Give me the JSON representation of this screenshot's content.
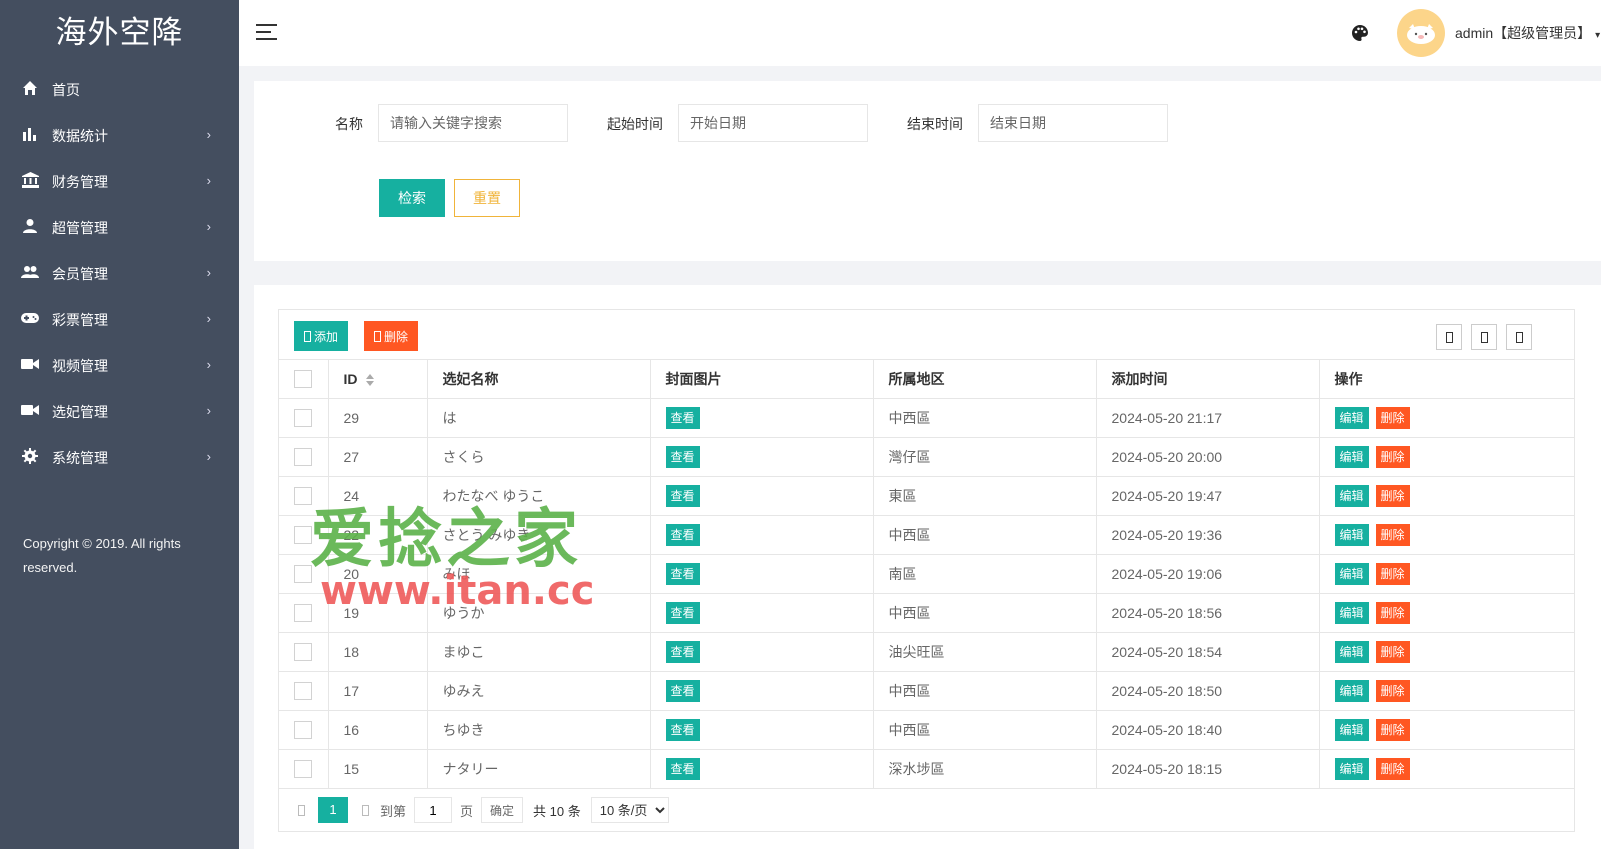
{
  "app": {
    "brand": "海外空降",
    "copyright": "Copyright © 2019. All rights reserved."
  },
  "sidebar": {
    "items": [
      {
        "label": "首页",
        "icon": "home-icon",
        "has_children": false
      },
      {
        "label": "数据统计",
        "icon": "bar-chart-icon",
        "has_children": true
      },
      {
        "label": "财务管理",
        "icon": "bank-icon",
        "has_children": true
      },
      {
        "label": "超管管理",
        "icon": "user-icon",
        "has_children": true
      },
      {
        "label": "会员管理",
        "icon": "users-icon",
        "has_children": true
      },
      {
        "label": "彩票管理",
        "icon": "gamepad-icon",
        "has_children": true
      },
      {
        "label": "视频管理",
        "icon": "video-camera-icon",
        "has_children": true
      },
      {
        "label": "选妃管理",
        "icon": "video-camera-icon",
        "has_children": true
      },
      {
        "label": "系统管理",
        "icon": "gear-icon",
        "has_children": true
      }
    ],
    "arrow": "›"
  },
  "header": {
    "user": "admin【超级管理员】",
    "caret": "▾"
  },
  "search": {
    "name_label": "名称",
    "name_placeholder": "请输入关键字搜索",
    "start_label": "起始时间",
    "start_placeholder": "开始日期",
    "end_label": "结束时间",
    "end_placeholder": "结束日期",
    "search_button": "检索",
    "reset_button": "重置"
  },
  "toolbar": {
    "add_label": "添加",
    "delete_label": "删除"
  },
  "table": {
    "columns": [
      "ID",
      "选妃名称",
      "封面图片",
      "所属地区",
      "添加时间",
      "操作"
    ],
    "view_label": "查看",
    "edit_label": "编辑",
    "remove_label": "删除",
    "rows": [
      {
        "id": "29",
        "name": "は",
        "region": "中西區",
        "time": "2024-05-20 21:17"
      },
      {
        "id": "27",
        "name": "さくら",
        "region": "灣仔區",
        "time": "2024-05-20 20:00"
      },
      {
        "id": "24",
        "name": "わたなべ ゆうこ",
        "region": "東區",
        "time": "2024-05-20 19:47"
      },
      {
        "id": "22",
        "name": "さとう みゆき",
        "region": "中西區",
        "time": "2024-05-20 19:36"
      },
      {
        "id": "20",
        "name": "みほ",
        "region": "南區",
        "time": "2024-05-20 19:06"
      },
      {
        "id": "19",
        "name": "ゆうか",
        "region": "中西區",
        "time": "2024-05-20 18:56"
      },
      {
        "id": "18",
        "name": "まゆこ",
        "region": "油尖旺區",
        "time": "2024-05-20 18:54"
      },
      {
        "id": "17",
        "name": "ゆみえ",
        "region": "中西區",
        "time": "2024-05-20 18:50"
      },
      {
        "id": "16",
        "name": "ちゆき",
        "region": "中西區",
        "time": "2024-05-20 18:40"
      },
      {
        "id": "15",
        "name": "ナタリー",
        "region": "深水埗區",
        "time": "2024-05-20 18:15"
      }
    ]
  },
  "pager": {
    "current": "1",
    "goto_label": "到第",
    "page_input": "1",
    "page_unit": "页",
    "confirm": "确定",
    "total": "共 10 条",
    "limit": "10 条/页"
  },
  "watermark": {
    "cn": "爱捻之家",
    "url": "www.itan.cc"
  },
  "colors": {
    "sidebar_bg": "#444e5f",
    "primary": "#16b0a0",
    "danger": "#ff5722",
    "warning": "#f0b43a"
  }
}
